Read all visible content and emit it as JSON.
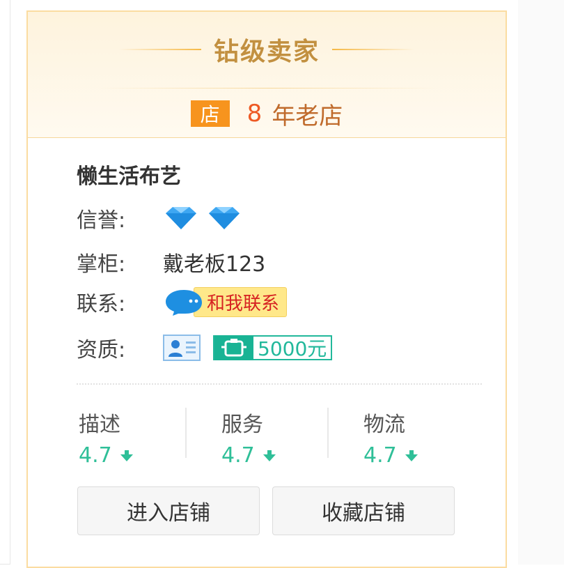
{
  "header": {
    "level_title": "钻级卖家",
    "shop_badge": "店",
    "years": "8",
    "years_suffix": "年老店"
  },
  "shop": {
    "name": "懒生活布艺",
    "credit_label": "信誉:",
    "credit_icon": "diamond-icon",
    "credit_diamonds": 2,
    "owner_label": "掌柜:",
    "owner_name": "戴老板123",
    "contact_label": "联系:",
    "contact_button": "和我联系",
    "qualification_label": "资质:",
    "deposit_text": "5000元"
  },
  "ratings": [
    {
      "label": "描述",
      "score": "4.7",
      "trend": "down"
    },
    {
      "label": "服务",
      "score": "4.7",
      "trend": "down"
    },
    {
      "label": "物流",
      "score": "4.7",
      "trend": "down"
    }
  ],
  "actions": {
    "enter_store": "进入店铺",
    "favorite_store": "收藏店铺"
  },
  "colors": {
    "accent_orange": "#f7941e",
    "title_gold": "#c29040",
    "score_green": "#2fbf98",
    "deposit_green": "#22b89b",
    "contact_red": "#d62222",
    "diamond_blue": "#3ea7f2"
  }
}
